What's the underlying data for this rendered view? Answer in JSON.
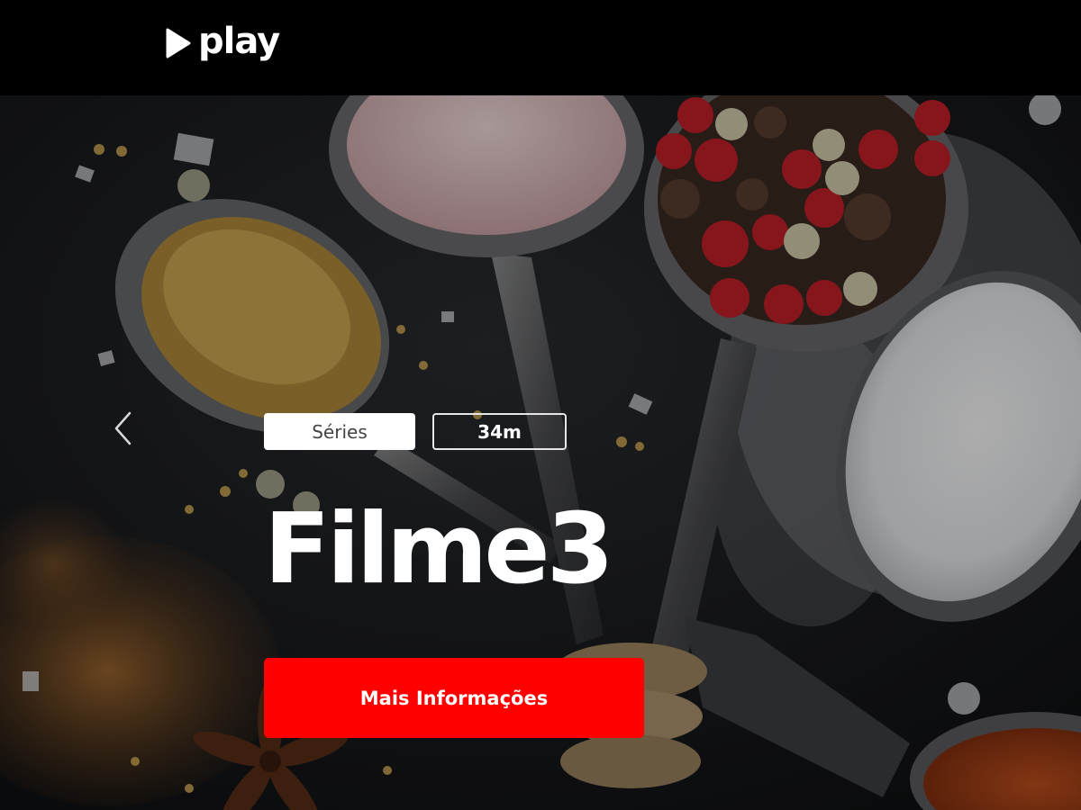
{
  "header": {
    "logo_text": "play",
    "logo_icon": "play-triangle-icon",
    "background_color": "#000000"
  },
  "hero": {
    "background_image": "spices-in-spoons",
    "category_tag": "Séries",
    "duration_tag": "34m",
    "title": "Filme3",
    "cta_label": "Mais Informações",
    "cta_color": "#fe0000",
    "prev_icon": "chevron-left-icon"
  }
}
